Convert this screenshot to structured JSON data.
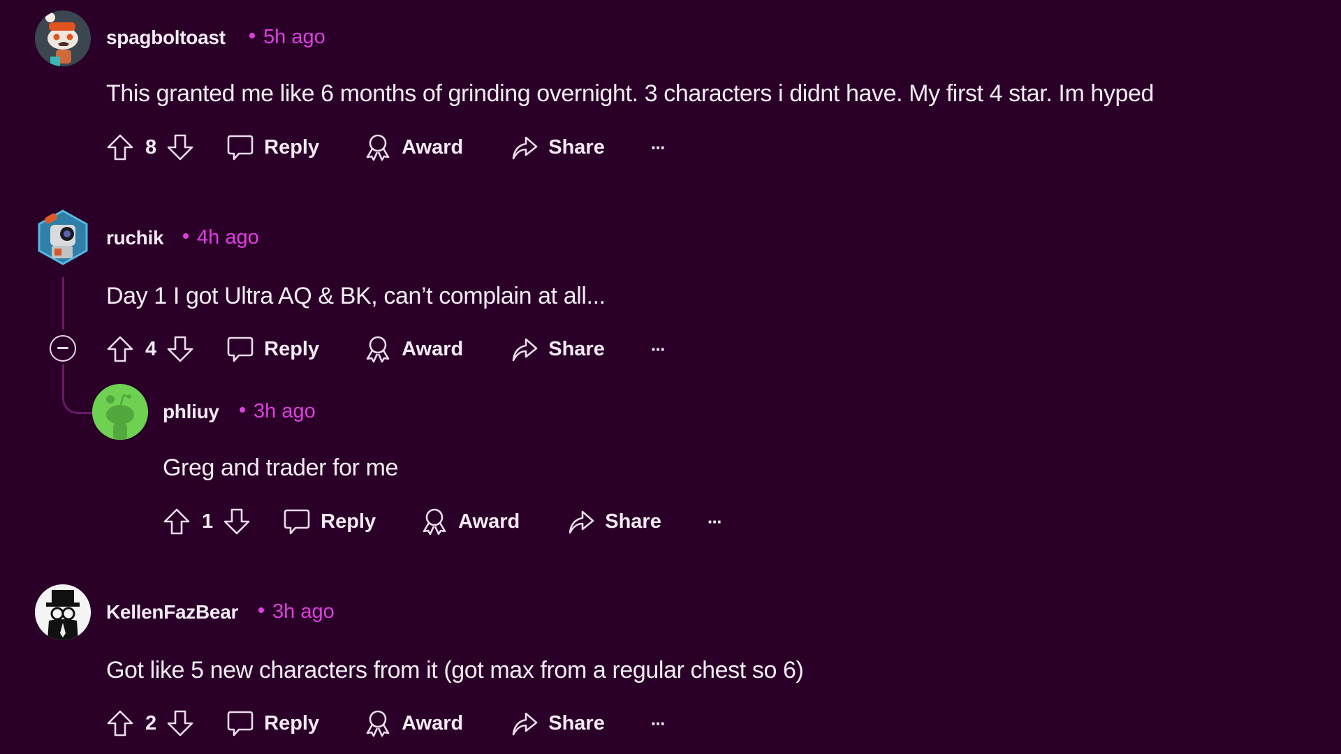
{
  "theme": {
    "background": "#2a0028",
    "timestamp_color": "#de3fe0",
    "thread_line_color": "#6a1968"
  },
  "comments": [
    {
      "username": "spagboltoast",
      "time": "5h ago",
      "body": "This granted me like 6 months of grinding overnight. 3 characters i didnt have. My first 4 star. Im hyped",
      "votes": "8",
      "avatar": "snoo-chef-avatar"
    },
    {
      "username": "ruchik",
      "time": "4h ago",
      "body": "Day 1 I got Ultra AQ & BK, can’t complain at all...",
      "votes": "4",
      "avatar": "robot-hex-avatar",
      "replies": [
        {
          "username": "phliuy",
          "time": "3h ago",
          "body": "Greg and trader for me",
          "votes": "1",
          "avatar": "default-green-snoo-avatar"
        }
      ]
    },
    {
      "username": "KellenFazBear",
      "time": "3h ago",
      "body": "Got like 5 new characters from it (got max from a regular chest so 6)",
      "votes": "2",
      "avatar": "top-hat-avatar"
    }
  ],
  "actions": {
    "reply": "Reply",
    "award": "Award",
    "share": "Share",
    "more": "···"
  }
}
